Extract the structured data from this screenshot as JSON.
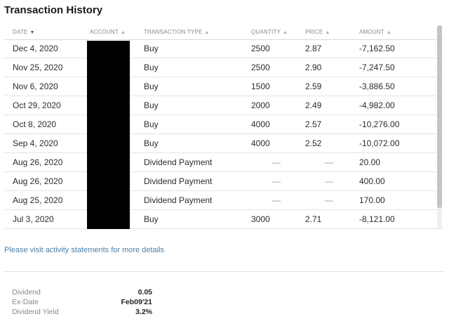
{
  "section": {
    "title": "Transaction History"
  },
  "table": {
    "headers": {
      "date": "DATE",
      "account": "ACCOUNT",
      "type": "TRANSACTION TYPE",
      "quantity": "QUANTITY",
      "price": "PRICE",
      "amount": "AMOUNT"
    },
    "sort_glyph_active": "▼",
    "sort_glyph_inactive": "▲",
    "rows": [
      {
        "date": "Dec 4, 2020",
        "type": "Buy",
        "quantity": "2500",
        "price": "2.87",
        "amount": "-7,162.50"
      },
      {
        "date": "Nov 25, 2020",
        "type": "Buy",
        "quantity": "2500",
        "price": "2.90",
        "amount": "-7,247.50"
      },
      {
        "date": "Nov 6, 2020",
        "type": "Buy",
        "quantity": "1500",
        "price": "2.59",
        "amount": "-3,886.50"
      },
      {
        "date": "Oct 29, 2020",
        "type": "Buy",
        "quantity": "2000",
        "price": "2.49",
        "amount": "-4,982.00"
      },
      {
        "date": "Oct 8, 2020",
        "type": "Buy",
        "quantity": "4000",
        "price": "2.57",
        "amount": "-10,276.00"
      },
      {
        "date": "Sep 4, 2020",
        "type": "Buy",
        "quantity": "4000",
        "price": "2.52",
        "amount": "-10,072.00"
      },
      {
        "date": "Aug 26, 2020",
        "type": "Dividend Payment",
        "quantity": "—",
        "price": "—",
        "amount": "20.00"
      },
      {
        "date": "Aug 26, 2020",
        "type": "Dividend Payment",
        "quantity": "—",
        "price": "—",
        "amount": "400.00"
      },
      {
        "date": "Aug 25, 2020",
        "type": "Dividend Payment",
        "quantity": "—",
        "price": "—",
        "amount": "170.00"
      },
      {
        "date": "Jul 3, 2020",
        "type": "Buy",
        "quantity": "3000",
        "price": "2.71",
        "amount": "-8,121.00"
      }
    ]
  },
  "footer": {
    "activity_link": "Please visit activity statements for more details"
  },
  "stats": {
    "dividend_label": "Dividend",
    "dividend_value": "0.05",
    "exdate_label": "Ex-Date",
    "exdate_value": "Feb09'21",
    "yield_label": "Dividend Yield",
    "yield_value": "3.2%"
  },
  "colors": {
    "link": "#4a7fa8",
    "redaction": "#000000"
  }
}
